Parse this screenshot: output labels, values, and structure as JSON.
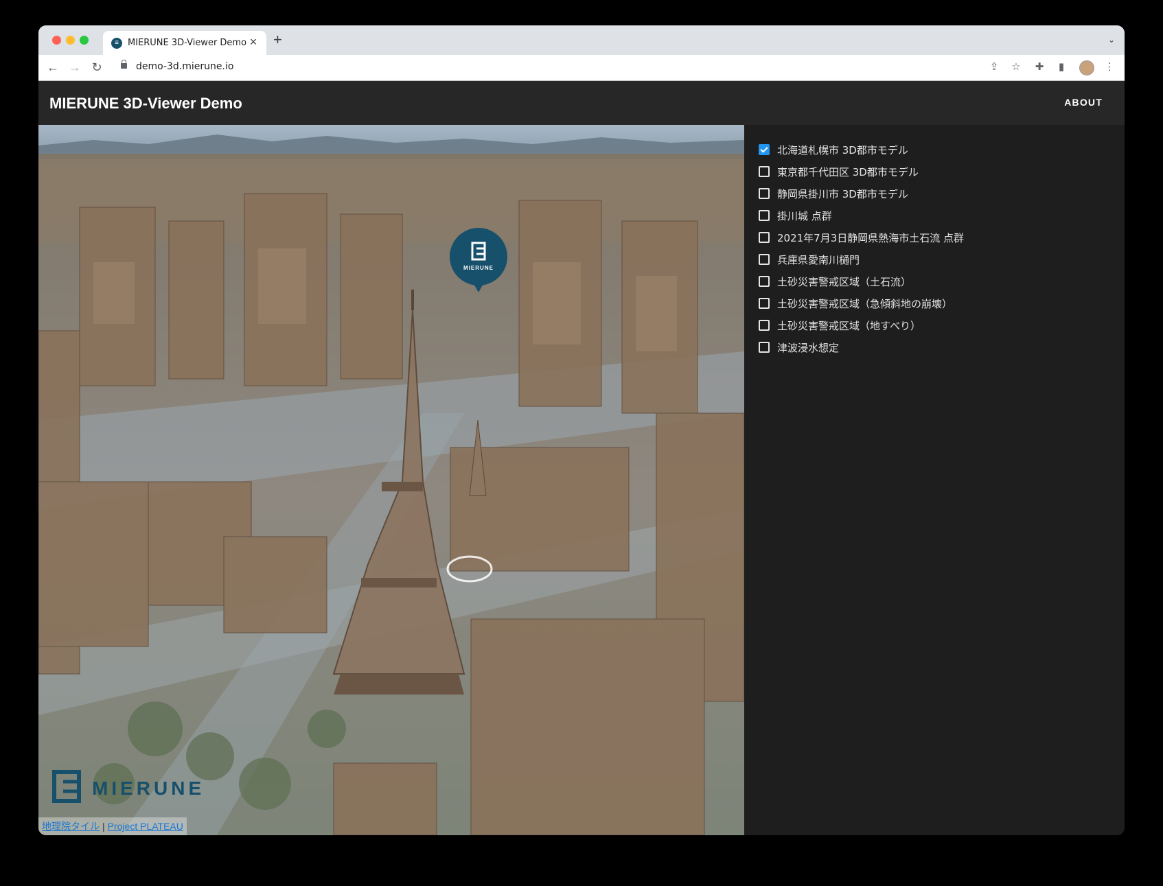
{
  "browser": {
    "tab_title": "MIERUNE 3D-Viewer Demo",
    "url": "demo-3d.mierune.io"
  },
  "app": {
    "title": "MIERUNE 3D-Viewer Demo",
    "about_label": "ABOUT"
  },
  "map": {
    "pin_label": "MIERUNE",
    "logo_text": "MIERUNE",
    "brand_color": "#17506b",
    "attribution": {
      "gsi": "地理院タイル",
      "separator": "|",
      "plateau": "Project PLATEAU"
    }
  },
  "layers": [
    {
      "label": "北海道札幌市 3D都市モデル",
      "checked": true
    },
    {
      "label": "東京都千代田区 3D都市モデル",
      "checked": false
    },
    {
      "label": "静岡県掛川市 3D都市モデル",
      "checked": false
    },
    {
      "label": "掛川城 点群",
      "checked": false
    },
    {
      "label": "2021年7月3日静岡県熱海市土石流 点群",
      "checked": false
    },
    {
      "label": "兵庫県愛南川樋門",
      "checked": false
    },
    {
      "label": "土砂災害警戒区域（土石流）",
      "checked": false
    },
    {
      "label": "土砂災害警戒区域（急傾斜地の崩壊）",
      "checked": false
    },
    {
      "label": "土砂災害警戒区域（地すべり）",
      "checked": false
    },
    {
      "label": "津波浸水想定",
      "checked": false
    }
  ],
  "colors": {
    "header_bg": "#272727",
    "panel_bg": "#1e1e1e",
    "checkbox_active": "#2196f3"
  }
}
